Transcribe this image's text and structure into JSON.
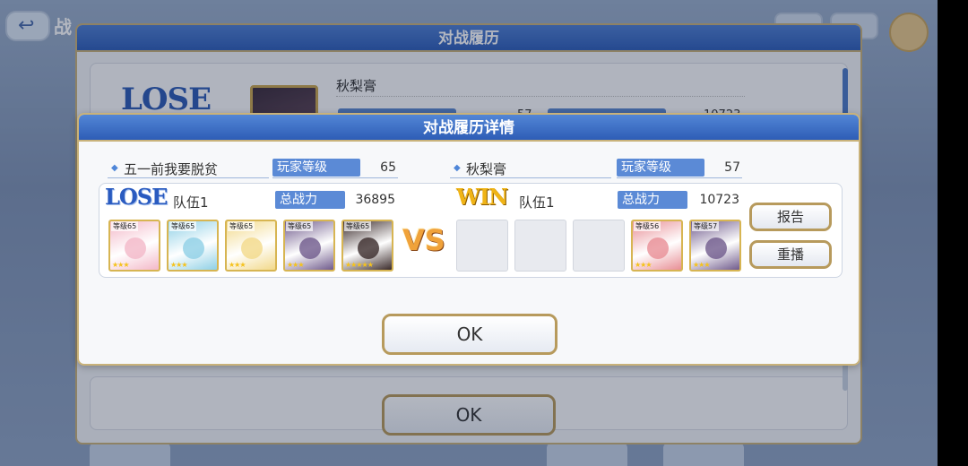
{
  "background": {
    "back_icon": "back-arrow-icon",
    "title_fragment": "战",
    "history_title": "对战履历",
    "history_entry": {
      "result": "LOSE",
      "opponent_name": "秋梨膏",
      "level_value": "57",
      "power_value": "10723"
    },
    "ok_label": "OK"
  },
  "dialog": {
    "title": "对战履历详情",
    "left": {
      "player_name": "五一前我要脱贫",
      "level_label": "玩家等级",
      "level": "65",
      "result": "LOSE",
      "team_label": "队伍1",
      "power_label": "总战力",
      "power": "36895",
      "units": [
        {
          "level": "等级65",
          "stars": "★★★",
          "color": "#f3b8c8"
        },
        {
          "level": "等级65",
          "stars": "★★★",
          "color": "#8fd0e6"
        },
        {
          "level": "等级65",
          "stars": "★★★",
          "color": "#f2d98a"
        },
        {
          "level": "等级65",
          "stars": "★★★",
          "color": "#6f5a8c"
        },
        {
          "level": "等级65",
          "stars": "★★★★★",
          "color": "#3a2a2a"
        }
      ]
    },
    "vs": "VS",
    "right": {
      "player_name": "秋梨膏",
      "level_label": "玩家等级",
      "level": "57",
      "result": "WIN",
      "team_label": "队伍1",
      "power_label": "总战力",
      "power": "10723",
      "empty_slots": 3,
      "units": [
        {
          "level": "等级56",
          "stars": "★★★",
          "color": "#e88f96"
        },
        {
          "level": "等级57",
          "stars": "★★★",
          "color": "#6f5a8c"
        }
      ]
    },
    "report_label": "报告",
    "replay_label": "重播",
    "ok_label": "OK"
  }
}
